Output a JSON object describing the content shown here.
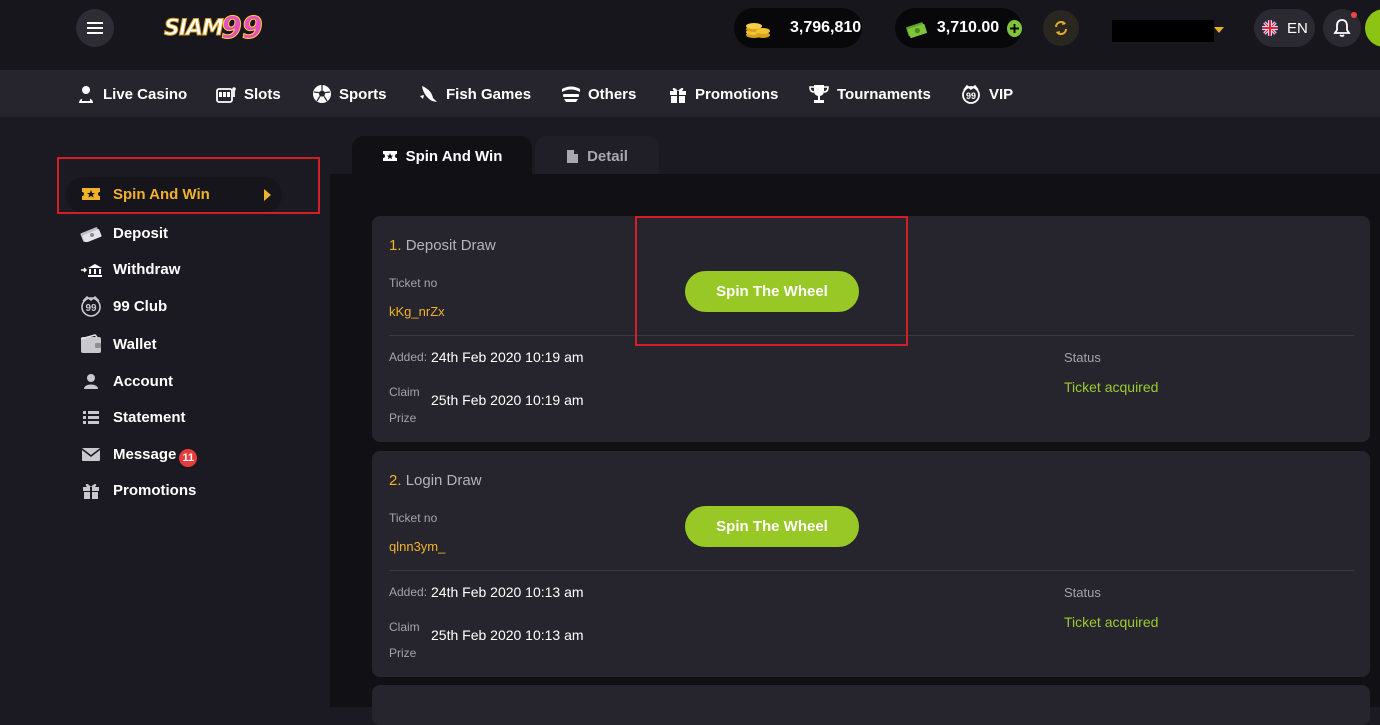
{
  "header": {
    "logo_text": "SIAM",
    "logo_number": "99",
    "coins_balance": "3,796,810",
    "cash_balance": "3,710.00",
    "language": "EN"
  },
  "nav": {
    "items": [
      {
        "label": "Live Casino",
        "icon": "live-casino-icon"
      },
      {
        "label": "Slots",
        "icon": "slot-machine-icon"
      },
      {
        "label": "Sports",
        "icon": "soccer-ball-icon"
      },
      {
        "label": "Fish Games",
        "icon": "fish-icon"
      },
      {
        "label": "Others",
        "icon": "others-icon"
      },
      {
        "label": "Promotions",
        "icon": "gift-icon"
      },
      {
        "label": "Tournaments",
        "icon": "trophy-icon"
      },
      {
        "label": "VIP",
        "icon": "vip-icon"
      }
    ]
  },
  "sidebar": {
    "active_label": "Spin And Win",
    "items": [
      {
        "label": "Deposit",
        "icon": "deposit-icon"
      },
      {
        "label": "Withdraw",
        "icon": "withdraw-icon"
      },
      {
        "label": "99 Club",
        "icon": "club-icon"
      },
      {
        "label": "Wallet",
        "icon": "wallet-icon"
      },
      {
        "label": "Account",
        "icon": "account-icon"
      },
      {
        "label": "Statement",
        "icon": "statement-icon"
      },
      {
        "label": "Message",
        "icon": "mail-icon",
        "badge": "11"
      },
      {
        "label": "Promotions",
        "icon": "gift-icon"
      }
    ]
  },
  "tabs": [
    {
      "label": "Spin And Win",
      "active": true
    },
    {
      "label": "Detail",
      "active": false
    }
  ],
  "draws": [
    {
      "index": "1.",
      "name": "Deposit Draw",
      "ticket_label": "Ticket no",
      "ticket_no": "kKg_nrZx",
      "button_label": "Spin The Wheel",
      "added_label": "Added:",
      "added_value": "24th Feb 2020 10:19 am",
      "claim_label": "Claim Prize",
      "claim_value": "25th Feb 2020 10:19 am",
      "status_label": "Status",
      "status_value": "Ticket acquired"
    },
    {
      "index": "2.",
      "name": "Login Draw",
      "ticket_label": "Ticket no",
      "ticket_no": "qlnn3ym_",
      "button_label": "Spin The Wheel",
      "added_label": "Added:",
      "added_value": "24th Feb 2020 10:13 am",
      "claim_label": "Claim Prize",
      "claim_value": "25th Feb 2020 10:13 am",
      "status_label": "Status",
      "status_value": "Ticket acquired"
    }
  ],
  "colors": {
    "accent_gold": "#f1b22a",
    "accent_green": "#97c825",
    "highlight_red": "#d21f26",
    "badge_red": "#e83b3b"
  }
}
